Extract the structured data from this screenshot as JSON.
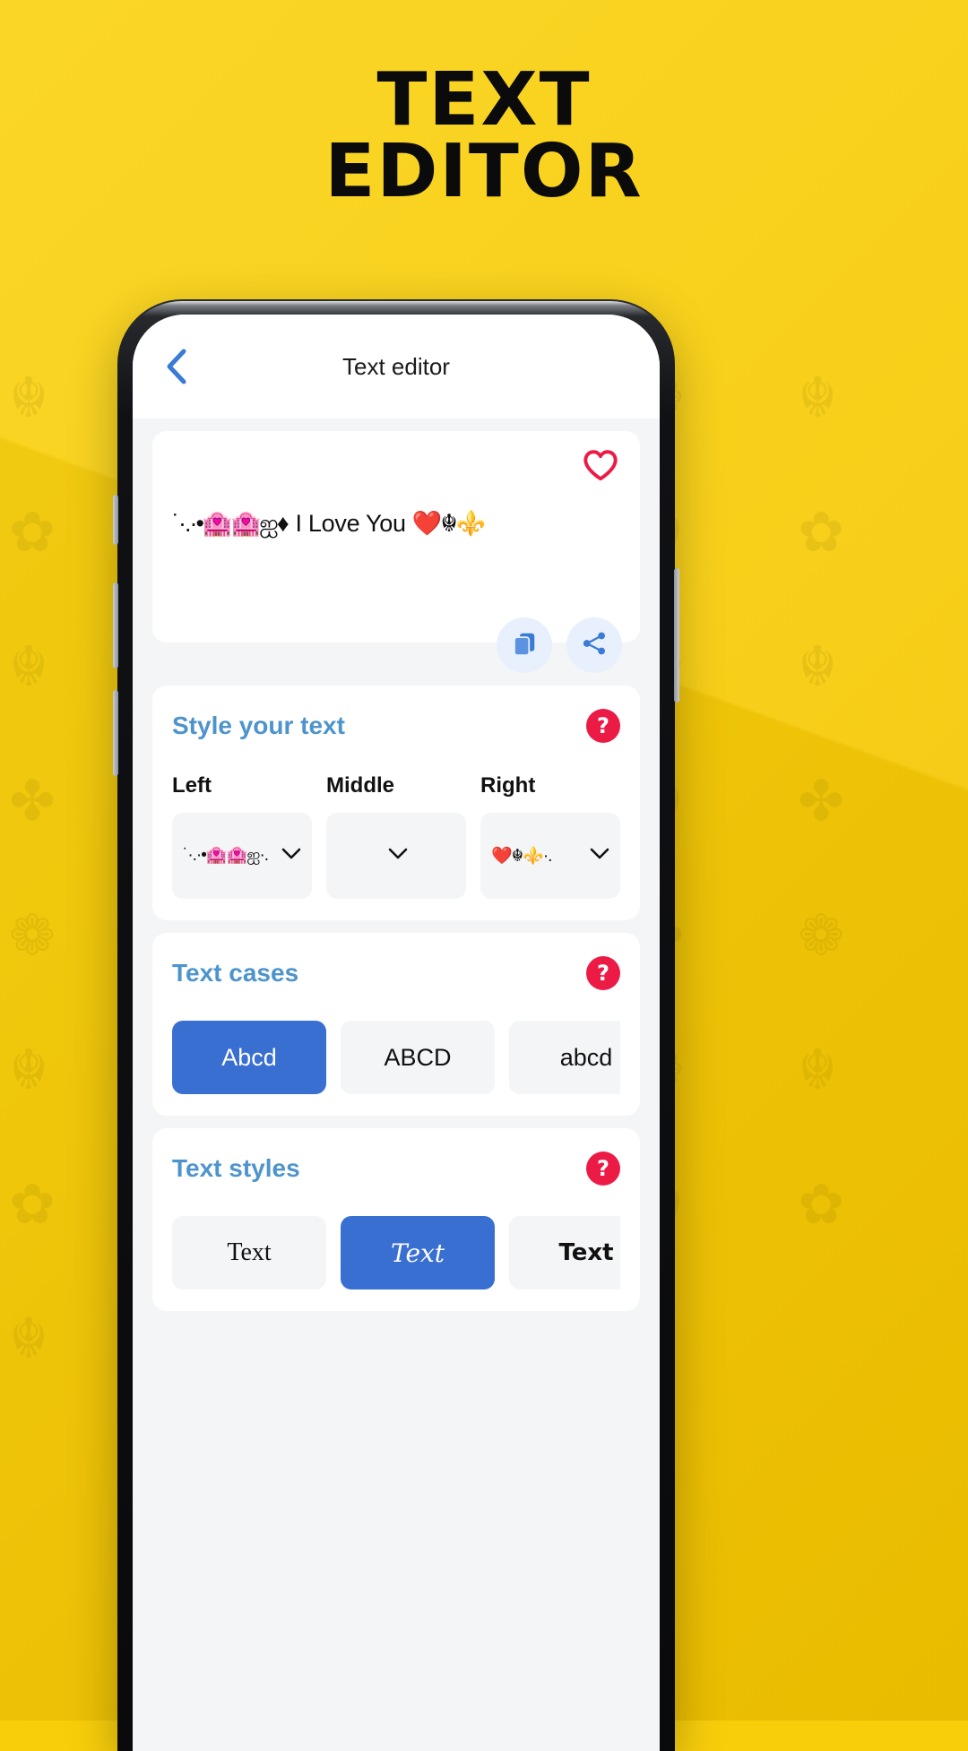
{
  "hero": {
    "line1": "TEXT",
    "line2": "EDITOR",
    "bg_color": "#F8CE0B",
    "title_color": "#0B0B0B"
  },
  "app": {
    "header": {
      "back_icon": "chevron-left-icon",
      "title": "Text editor",
      "accent_color": "#3A6FD2"
    },
    "preview": {
      "favorite_icon": "heart-outline-icon",
      "favorite_color": "#EC1B46",
      "text": "˙·.·•🏩🏩ஐ ♦ I Love You ❤️☬⚜️·.·˙",
      "text_left": "˙·.·•🏩🏩ஐ",
      "text_diamond": "♦",
      "text_middle": "I Love You",
      "text_right": "❤️☬⚜️",
      "copy_icon": "copy-icon",
      "share_icon": "share-icon",
      "action_bg": "#E8F0FE",
      "action_fg": "#3A6FD2"
    },
    "style_section": {
      "title": "Style your text",
      "help_icon": "question-mark-icon",
      "help_color": "#EC1B46",
      "title_color": "#4E94CC",
      "columns": [
        {
          "label": "Left",
          "value": "˙·.·•🏩🏩ஐ·.",
          "icon": "chevron-down-icon"
        },
        {
          "label": "Middle",
          "value": "",
          "icon": "chevron-down-icon"
        },
        {
          "label": "Right",
          "value": "❤️☬⚜️·.",
          "icon": "chevron-down-icon"
        }
      ]
    },
    "cases_section": {
      "title": "Text cases",
      "help_icon": "question-mark-icon",
      "options": [
        {
          "label": "Abcd",
          "selected": true
        },
        {
          "label": "ABCD",
          "selected": false
        },
        {
          "label": "abcd",
          "selected": false
        },
        {
          "label": "",
          "selected": false
        }
      ]
    },
    "styles_section": {
      "title": "Text styles",
      "help_icon": "question-mark-icon",
      "options": [
        {
          "label": "Text",
          "selected": false,
          "style": "style-serif"
        },
        {
          "label": "Text",
          "selected": true,
          "style": "style-fancy"
        },
        {
          "label": "Text",
          "selected": false,
          "style": "style-bold"
        },
        {
          "label": "",
          "selected": false,
          "style": ""
        }
      ]
    },
    "selected_color": "#3A6FD2",
    "surface_color": "#F4F5F7"
  },
  "decor": {
    "pattern_glyphs": "☬ ✿ ☬ ✤ ❁ ☬ ✿ ☬ ✤ ❁ ☬ ✿ ☬ ✤ ❁ ☬ ✿ ☬ ✤ ❁ ☬ ✿ ☬ ✤ ❁ ☬ ✿ ☬ ✤ ❁ ☬ ✿ ☬ ✤ ❁ ☬ ✿ ☬ ✤ ❁ ☬ ✿ ☬"
  }
}
